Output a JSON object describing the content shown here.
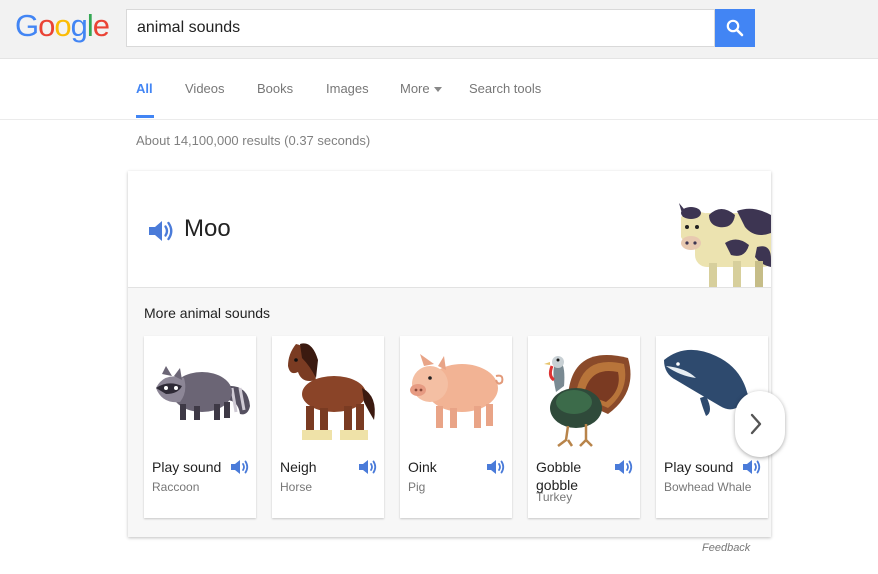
{
  "logo": {
    "letters": [
      "G",
      "o",
      "o",
      "g",
      "l",
      "e"
    ],
    "colors": [
      "#4285f4",
      "#ea4335",
      "#fbbc05",
      "#4285f4",
      "#34a853",
      "#ea4335"
    ]
  },
  "search": {
    "query": "animal sounds",
    "button_icon": "search-icon"
  },
  "tabs": [
    {
      "label": "All",
      "active": true
    },
    {
      "label": "Videos"
    },
    {
      "label": "Books"
    },
    {
      "label": "Images"
    },
    {
      "label": "More"
    },
    {
      "label": "Search tools"
    }
  ],
  "result_stats": "About 14,100,000 results (0.37 seconds)",
  "featured": {
    "sound_label": "Moo",
    "icon": "speaker-icon",
    "image": "cow-illustration"
  },
  "more_sounds": {
    "title": "More animal sounds",
    "items": [
      {
        "sound": "Play sound",
        "animal": "Raccoon"
      },
      {
        "sound": "Neigh",
        "animal": "Horse"
      },
      {
        "sound": "Oink",
        "animal": "Pig"
      },
      {
        "sound": "Gobble gobble",
        "animal": "Turkey"
      },
      {
        "sound": "Play sound",
        "animal": "Bowhead Whale"
      }
    ],
    "next_icon": "chevron-right-icon"
  },
  "feedback": "Feedback",
  "colors": {
    "accent": "#4285f4",
    "speaker": "#4a7bd9",
    "muted": "#777777"
  }
}
